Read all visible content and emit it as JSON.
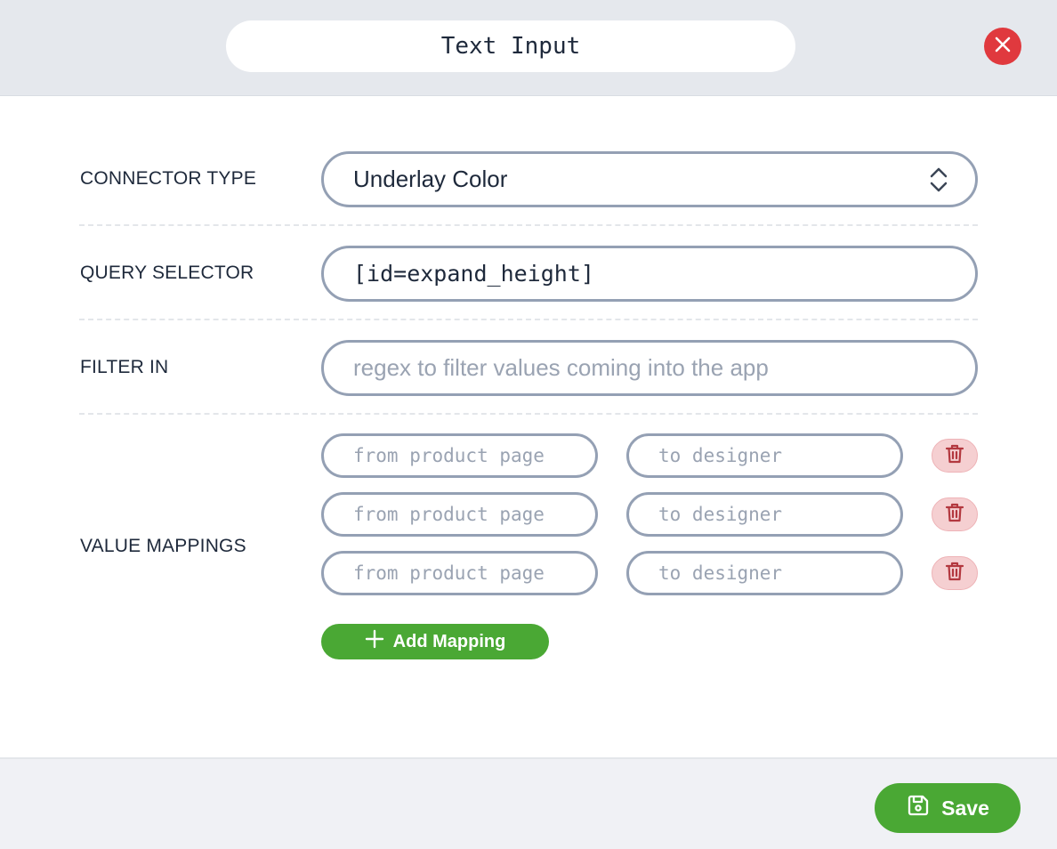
{
  "header": {
    "title": "Text Input",
    "close_icon": "close-icon"
  },
  "form": {
    "connector_type": {
      "label": "CONNECTOR TYPE",
      "value": "Underlay Color"
    },
    "query_selector": {
      "label": "QUERY SELECTOR",
      "value": "[id=expand_height]"
    },
    "filter_in": {
      "label": "FILTER IN",
      "placeholder": "regex to filter values coming into the app"
    },
    "value_mappings": {
      "label": "VALUE MAPPINGS",
      "rows": [
        {
          "from_placeholder": "from product page",
          "to_placeholder": "to designer"
        },
        {
          "from_placeholder": "from product page",
          "to_placeholder": "to designer"
        },
        {
          "from_placeholder": "from product page",
          "to_placeholder": "to designer"
        }
      ],
      "add_label": "Add Mapping"
    }
  },
  "footer": {
    "save_label": "Save"
  },
  "colors": {
    "header_bg": "#e5e8ed",
    "close": "#e0393e",
    "accent_green": "#4aa834",
    "field_border": "#94a0b4",
    "trash_bg": "#f5cfd1",
    "trash_icon": "#b3383f"
  }
}
